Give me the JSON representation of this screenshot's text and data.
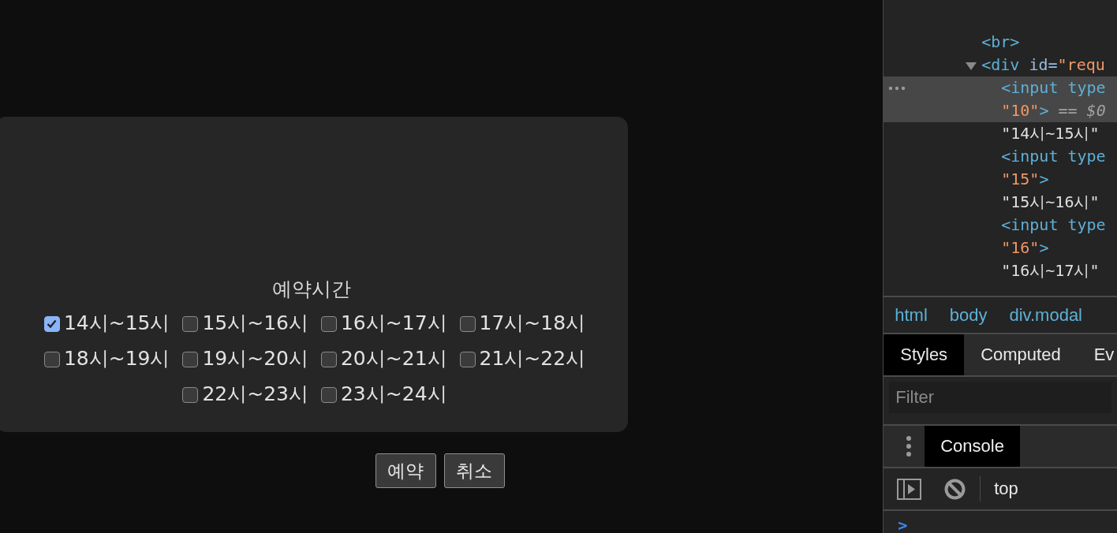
{
  "modal": {
    "title": "예약시간",
    "options": [
      {
        "label": "14시~15시",
        "checked": true
      },
      {
        "label": "15시~16시",
        "checked": false
      },
      {
        "label": "16시~17시",
        "checked": false
      },
      {
        "label": "17시~18시",
        "checked": false
      },
      {
        "label": "18시~19시",
        "checked": false
      },
      {
        "label": "19시~20시",
        "checked": false
      },
      {
        "label": "20시~21시",
        "checked": false
      },
      {
        "label": "21시~22시",
        "checked": false
      },
      {
        "label": "22시~23시",
        "checked": false
      },
      {
        "label": "23시~24시",
        "checked": false
      }
    ],
    "buttons": [
      "예약",
      "취소"
    ]
  },
  "devtools": {
    "dom_nodes": [
      {
        "lines": [
          [
            {
              "text": "<br>",
              "kind": "tag"
            }
          ]
        ],
        "selected": false
      },
      {
        "lines": [
          [
            {
              "text": "<div",
              "kind": "tag"
            },
            {
              "text": " id=",
              "kind": "attr"
            },
            {
              "text": "\"requ",
              "kind": "value"
            }
          ]
        ],
        "selected": false,
        "expanded": true,
        "children": [
          {
            "lines": [
              [
                {
                  "text": "<input type",
                  "kind": "tag"
                }
              ],
              [
                {
                  "text": "\"10\"",
                  "kind": "value"
                },
                {
                  "text": ">",
                  "kind": "tag"
                },
                {
                  "text": " == $0",
                  "kind": "ref"
                }
              ]
            ],
            "selected": true
          },
          {
            "lines": [
              [
                {
                  "text": "\"14시~15시\"",
                  "kind": "text"
                }
              ]
            ],
            "selected": false
          },
          {
            "lines": [
              [
                {
                  "text": "<input type",
                  "kind": "tag"
                }
              ],
              [
                {
                  "text": "\"15\"",
                  "kind": "value"
                },
                {
                  "text": ">",
                  "kind": "tag"
                }
              ]
            ],
            "selected": false
          },
          {
            "lines": [
              [
                {
                  "text": "\"15시~16시\"",
                  "kind": "text"
                }
              ]
            ],
            "selected": false
          },
          {
            "lines": [
              [
                {
                  "text": "<input type",
                  "kind": "tag"
                }
              ],
              [
                {
                  "text": "\"16\"",
                  "kind": "value"
                },
                {
                  "text": ">",
                  "kind": "tag"
                }
              ]
            ],
            "selected": false
          },
          {
            "lines": [
              [
                {
                  "text": "\"16시~17시\"",
                  "kind": "text"
                }
              ]
            ],
            "selected": false
          }
        ]
      }
    ],
    "breadcrumbs": [
      "html",
      "body",
      "div.modal"
    ],
    "tabs": [
      {
        "label": "Styles",
        "selected": true
      },
      {
        "label": "Computed",
        "selected": false
      },
      {
        "label": "Ev",
        "selected": false
      }
    ],
    "filter": {
      "placeholder": "Filter"
    },
    "drawer_tabs": [
      {
        "label": "Console",
        "selected": true
      }
    ],
    "context": "top",
    "prompt": ">"
  }
}
